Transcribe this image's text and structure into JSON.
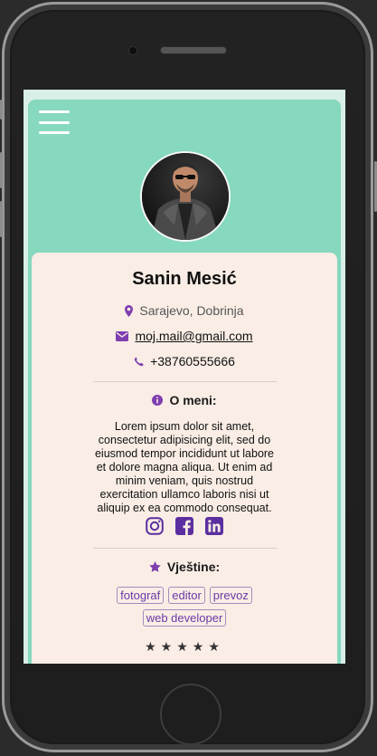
{
  "profile": {
    "name": "Sanin Mesić",
    "location": "Sarajevo, Dobrinja",
    "email": "moj.mail@gmail.com",
    "phone": "+38760555666"
  },
  "about": {
    "heading": "O meni:",
    "text": "Lorem ipsum dolor sit amet, consectetur adipisicing elit, sed do eiusmod tempor incididunt ut labore et dolore magna aliqua. Ut enim ad minim veniam, quis nostrud exercitation ullamco laboris nisi ut aliquip ex ea commodo consequat."
  },
  "socials": [
    "instagram-icon",
    "facebook-icon",
    "linkedin-icon"
  ],
  "skills": {
    "heading": "Vještine:",
    "tags": [
      "fotograf",
      "editor",
      "prevoz",
      "web developer"
    ]
  },
  "rating_stars_partial": "★★★★★",
  "colors": {
    "background": "#d7efe6",
    "header": "#86d8bf",
    "card": "#f9ede5",
    "accent": "#7e3fb0"
  }
}
